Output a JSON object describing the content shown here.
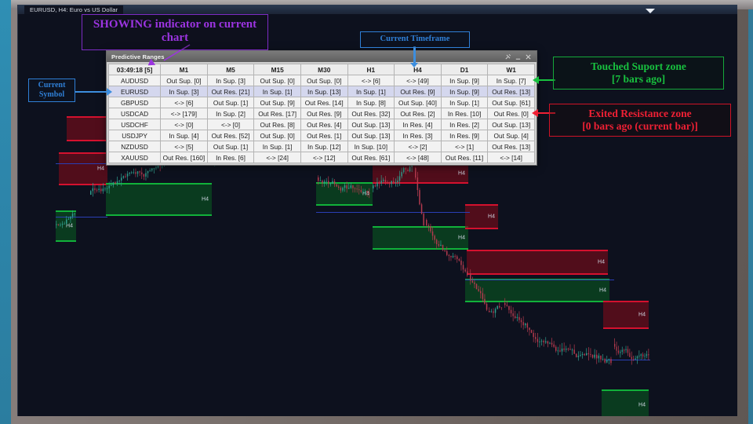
{
  "desktop": {
    "accent_teal": "#2d86ab",
    "frame_gray": "#7a716d"
  },
  "chart_window": {
    "tab_label": "EURUSD, H4: Euro vs US Dollar",
    "background": "#0d111e",
    "symbol": "EURUSD",
    "timeframe": "H4",
    "zone_label": "H4",
    "support_color": "#11b13a",
    "resistance_color": "#d4112e",
    "price_line_color": "#2a3fb5"
  },
  "panel": {
    "title": "Predictive Ranges",
    "pin_icon": "pin-icon",
    "minimize_icon": "minimize-icon",
    "close_icon": "close-icon",
    "timer_label": "03:49:18 [5]",
    "current_timeframe": "H4",
    "current_symbol": "EURUSD",
    "columns": [
      "M1",
      "M5",
      "M15",
      "M30",
      "H1",
      "H4",
      "D1",
      "W1"
    ],
    "rows": [
      {
        "symbol": "AUDUSD",
        "cells": [
          {
            "text": "Out Sup. [0]",
            "state": "sup"
          },
          {
            "text": "In Sup. [3]",
            "state": "sup"
          },
          {
            "text": "Out Sup. [0]",
            "state": "sup"
          },
          {
            "text": "Out Sup. [0]",
            "state": "sup"
          },
          {
            "text": "<-> [6]",
            "state": "neutral"
          },
          {
            "text": "<-> [49]",
            "state": "neutral"
          },
          {
            "text": "In Sup. [9]",
            "state": "sup"
          },
          {
            "text": "In Sup. [7]",
            "state": "sup"
          }
        ]
      },
      {
        "symbol": "EURUSD",
        "cells": [
          {
            "text": "In Sup. [3]",
            "state": "sup"
          },
          {
            "text": "Out Res. [21]",
            "state": "dark"
          },
          {
            "text": "In Sup. [1]",
            "state": "sup"
          },
          {
            "text": "In Sup. [13]",
            "state": "sup"
          },
          {
            "text": "In Sup. [1]",
            "state": "sup"
          },
          {
            "text": "Out Res. [9]",
            "state": "dark"
          },
          {
            "text": "In Sup. [9]",
            "state": "sup"
          },
          {
            "text": "Out Res. [13]",
            "state": "dark"
          }
        ]
      },
      {
        "symbol": "GBPUSD",
        "cells": [
          {
            "text": "<-> [6]",
            "state": "neutral"
          },
          {
            "text": "Out Sup. [1]",
            "state": "sup"
          },
          {
            "text": "Out Sup. [9]",
            "state": "dark"
          },
          {
            "text": "Out Res. [14]",
            "state": "dark"
          },
          {
            "text": "In Sup. [8]",
            "state": "sup"
          },
          {
            "text": "Out Sup. [40]",
            "state": "dark"
          },
          {
            "text": "In Sup. [1]",
            "state": "sup"
          },
          {
            "text": "Out Sup. [61]",
            "state": "dark"
          }
        ]
      },
      {
        "symbol": "USDCAD",
        "cells": [
          {
            "text": "<-> [179]",
            "state": "neutral"
          },
          {
            "text": "In Sup. [2]",
            "state": "sup"
          },
          {
            "text": "Out Res. [17]",
            "state": "dark"
          },
          {
            "text": "Out Res. [9]",
            "state": "dark"
          },
          {
            "text": "Out Res. [32]",
            "state": "dark"
          },
          {
            "text": "Out Res. [2]",
            "state": "dark"
          },
          {
            "text": "In Res. [10]",
            "state": "res"
          },
          {
            "text": "Out Res. [0]",
            "state": "res"
          }
        ]
      },
      {
        "symbol": "USDCHF",
        "cells": [
          {
            "text": "<-> [0]",
            "state": "neutral"
          },
          {
            "text": "<-> [0]",
            "state": "neutral"
          },
          {
            "text": "Out Res. [8]",
            "state": "dark"
          },
          {
            "text": "Out Res. [4]",
            "state": "dark"
          },
          {
            "text": "Out Sup. [13]",
            "state": "dark"
          },
          {
            "text": "In Res. [4]",
            "state": "res"
          },
          {
            "text": "In Res. [2]",
            "state": "res"
          },
          {
            "text": "Out Sup. [13]",
            "state": "dark"
          }
        ]
      },
      {
        "symbol": "USDJPY",
        "cells": [
          {
            "text": "In Sup. [4]",
            "state": "sup"
          },
          {
            "text": "Out Res. [52]",
            "state": "dark"
          },
          {
            "text": "Out Sup. [0]",
            "state": "sup"
          },
          {
            "text": "Out Res. [1]",
            "state": "res"
          },
          {
            "text": "Out Sup. [13]",
            "state": "dark"
          },
          {
            "text": "In Res. [3]",
            "state": "res"
          },
          {
            "text": "In Res. [9]",
            "state": "res"
          },
          {
            "text": "Out Sup. [4]",
            "state": "dark"
          }
        ]
      },
      {
        "symbol": "NZDUSD",
        "cells": [
          {
            "text": "<-> [5]",
            "state": "neutral"
          },
          {
            "text": "Out Sup. [1]",
            "state": "sup"
          },
          {
            "text": "In Sup. [1]",
            "state": "sup"
          },
          {
            "text": "In Sup. [12]",
            "state": "sup"
          },
          {
            "text": "In Sup. [10]",
            "state": "sup"
          },
          {
            "text": "<-> [2]",
            "state": "neutral"
          },
          {
            "text": "<-> [1]",
            "state": "neutral"
          },
          {
            "text": "Out Res. [13]",
            "state": "dark"
          }
        ]
      },
      {
        "symbol": "XAUUSD",
        "cells": [
          {
            "text": "Out Res. [160]",
            "state": "dark"
          },
          {
            "text": "In Res. [6]",
            "state": "res"
          },
          {
            "text": "<-> [24]",
            "state": "neutral"
          },
          {
            "text": "<-> [12]",
            "state": "neutral"
          },
          {
            "text": "Out Res. [61]",
            "state": "dark"
          },
          {
            "text": "<-> [48]",
            "state": "neutral"
          },
          {
            "text": "Out Res. [11]",
            "state": "dark"
          },
          {
            "text": "<-> [14]",
            "state": "neutral"
          }
        ]
      }
    ]
  },
  "annotations": {
    "showing": "SHOWING indicator on current chart",
    "showing_color": "#9b34e0",
    "timeframe": "Current Timeframe",
    "timeframe_color": "#2f7fd6",
    "symbol": "Current Symbol",
    "symbol_color": "#2f7fd6",
    "touched_line1": "Touched Suport zone",
    "touched_line2": "[7 bars ago]",
    "touched_color": "#18c13f",
    "exited_line1": "Exited Resistance zone",
    "exited_line2": "[0 bars ago (current bar)]",
    "exited_color": "#ef2034"
  }
}
